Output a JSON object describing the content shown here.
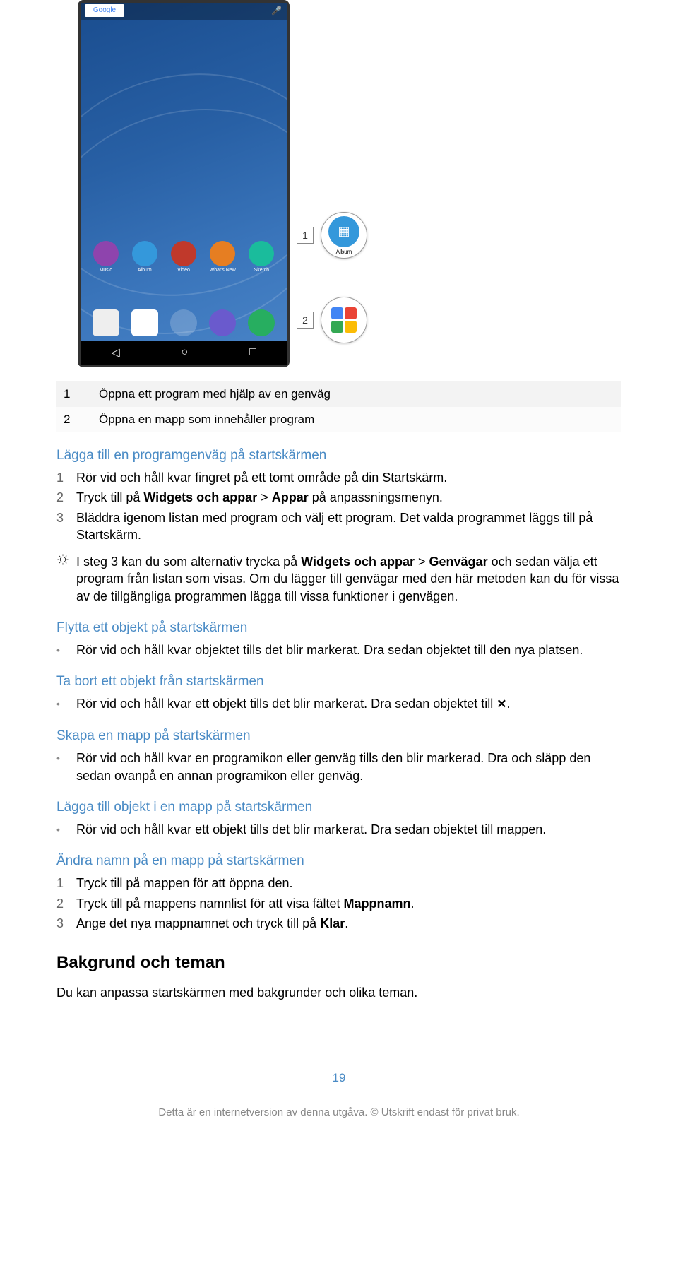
{
  "phone": {
    "google_label": "Google",
    "apps": [
      {
        "label": "Music",
        "color": "#8e44ad"
      },
      {
        "label": "Album",
        "color": "#3498db"
      },
      {
        "label": "Video",
        "color": "#c0392b"
      },
      {
        "label": "What's New",
        "color": "#e67e22"
      },
      {
        "label": "Sketch",
        "color": "#1abc9c"
      }
    ],
    "callout1_label": "Album",
    "callouts": {
      "c1": "1",
      "c2": "2"
    }
  },
  "legend": [
    {
      "num": "1",
      "text": "Öppna ett program med hjälp av en genväg"
    },
    {
      "num": "2",
      "text": "Öppna en mapp som innehåller program"
    }
  ],
  "sections": {
    "s1": {
      "heading": "Lägga till en programgenväg på startskärmen",
      "items": [
        {
          "n": "1",
          "text": "Rör vid och håll kvar fingret på ett tomt område på din Startskärm."
        },
        {
          "n": "2",
          "prefix": "Tryck till på ",
          "b1": "Widgets och appar",
          "mid": " > ",
          "b2": "Appar",
          "suffix": " på anpassningsmenyn."
        },
        {
          "n": "3",
          "text": "Bläddra igenom listan med program och välj ett program. Det valda programmet läggs till på Startskärm."
        }
      ],
      "tip": {
        "prefix": "I steg 3 kan du som alternativ trycka på ",
        "b1": "Widgets och appar",
        "mid": " > ",
        "b2": "Genvägar",
        "suffix": " och sedan välja ett program från listan som visas. Om du lägger till genvägar med den här metoden kan du för vissa av de tillgängliga programmen lägga till vissa funktioner i genvägen."
      }
    },
    "s2": {
      "heading": "Flytta ett objekt på startskärmen",
      "bullet": "Rör vid och håll kvar objektet tills det blir markerat. Dra sedan objektet till den nya platsen."
    },
    "s3": {
      "heading": "Ta bort ett objekt från startskärmen",
      "bullet_prefix": "Rör vid och håll kvar ett objekt tills det blir markerat. Dra sedan objektet till ",
      "bullet_suffix": "."
    },
    "s4": {
      "heading": "Skapa en mapp på startskärmen",
      "bullet": "Rör vid och håll kvar en programikon eller genväg tills den blir markerad. Dra och släpp den sedan ovanpå en annan programikon eller genväg."
    },
    "s5": {
      "heading": "Lägga till objekt i en mapp på startskärmen",
      "bullet": "Rör vid och håll kvar ett objekt tills det blir markerat. Dra sedan objektet till mappen."
    },
    "s6": {
      "heading": "Ändra namn på en mapp på startskärmen",
      "items": [
        {
          "n": "1",
          "text": "Tryck till på mappen för att öppna den."
        },
        {
          "n": "2",
          "prefix": "Tryck till på mappens namnlist för att visa fältet ",
          "b1": "Mappnamn",
          "suffix": "."
        },
        {
          "n": "3",
          "prefix": "Ange det nya mappnamnet och tryck till på ",
          "b1": "Klar",
          "suffix": "."
        }
      ]
    }
  },
  "main_heading": "Bakgrund och teman",
  "main_text": "Du kan anpassa startskärmen med bakgrunder och olika teman.",
  "page_number": "19",
  "footer": "Detta är en internetversion av denna utgåva. © Utskrift endast för privat bruk."
}
